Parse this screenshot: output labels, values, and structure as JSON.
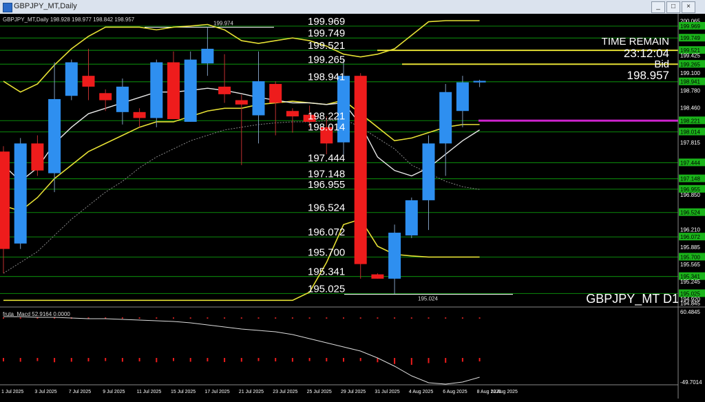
{
  "window": {
    "title": "GBPJPY_MT,Daily",
    "controls": [
      "minimize",
      "restore",
      "close"
    ]
  },
  "chart_header": "GBPJPY_MT,Daily  198.928 198.977 198.842 198.957",
  "symbol_label": "GBPJPY_MT D1",
  "time_remain": {
    "label": "TIME REMAIN",
    "value": "23:12:04"
  },
  "bid": {
    "label": "Bid",
    "value": "198.957"
  },
  "level_labels": [
    "199.969",
    "199.749",
    "199.521",
    "199.265",
    "198.941",
    "198.221",
    "198.014",
    "197.444",
    "197.148",
    "196.955",
    "196.524",
    "196.072",
    "195.700",
    "195.341",
    "195.025"
  ],
  "high_marker": "199.974",
  "low_marker": "195.024",
  "price_axis": [
    "200.065",
    "199.969",
    "199.749",
    "199.521",
    "199.425",
    "199.265",
    "199.100",
    "198.941",
    "198.780",
    "198.460",
    "198.221",
    "198.014",
    "197.815",
    "197.444",
    "197.148",
    "196.955",
    "196.850",
    "196.524",
    "196.210",
    "196.072",
    "195.885",
    "195.700",
    "195.565",
    "195.341",
    "195.245",
    "195.025",
    "194.920",
    "194.845"
  ],
  "axis_highlights": [
    "199.969",
    "199.749",
    "199.521",
    "199.265",
    "198.941",
    "198.221",
    "198.014",
    "197.444",
    "197.148",
    "196.955",
    "196.524",
    "196.072",
    "195.700",
    "195.341",
    "195.025"
  ],
  "macd": {
    "label": "fruta_Macd 52.9164 0.0000",
    "axis_top": "60.4845",
    "axis_bottom": "-49.7014"
  },
  "time_axis": [
    "1 Jul 2025",
    "3 Jul 2025",
    "7 Jul 2025",
    "9 Jul 2025",
    "11 Jul 2025",
    "15 Jul 2025",
    "17 Jul 2025",
    "21 Jul 2025",
    "23 Jul 2025",
    "25 Jul 2025",
    "29 Jul 2025",
    "31 Jul 2025",
    "4 Aug 2025",
    "6 Aug 2025",
    "8 Aug 2025",
    "12 Aug 2025"
  ],
  "colors": {
    "bull": "#2e8ff0",
    "bear": "#ee1c1c",
    "level_line": "#0a7a0a",
    "band": "#e6e034",
    "mid": "#e8e8e8",
    "magenta": "#cc22cc"
  },
  "chart_data": {
    "type": "candlestick",
    "series": [
      {
        "name": "GBPJPY_MT,Daily",
        "candles": [
          {
            "o": 197.65,
            "h": 197.75,
            "l": 195.4,
            "c": 195.85
          },
          {
            "o": 195.95,
            "h": 197.9,
            "l": 195.85,
            "c": 197.8
          },
          {
            "o": 197.8,
            "h": 197.95,
            "l": 197.2,
            "c": 197.3
          },
          {
            "o": 197.25,
            "h": 199.3,
            "l": 196.9,
            "c": 198.62
          },
          {
            "o": 198.68,
            "h": 199.35,
            "l": 198.6,
            "c": 199.3
          },
          {
            "o": 199.05,
            "h": 199.55,
            "l": 198.6,
            "c": 198.85
          },
          {
            "o": 198.73,
            "h": 198.8,
            "l": 198.4,
            "c": 198.6
          },
          {
            "o": 198.38,
            "h": 199.0,
            "l": 198.15,
            "c": 198.85
          },
          {
            "o": 198.38,
            "h": 198.45,
            "l": 198.1,
            "c": 198.27
          },
          {
            "o": 198.27,
            "h": 199.35,
            "l": 198.1,
            "c": 199.3
          },
          {
            "o": 199.3,
            "h": 199.5,
            "l": 198.4,
            "c": 198.25
          },
          {
            "o": 198.2,
            "h": 199.5,
            "l": 198.2,
            "c": 199.35
          },
          {
            "o": 199.28,
            "h": 199.95,
            "l": 199.05,
            "c": 199.55
          },
          {
            "o": 198.85,
            "h": 199.45,
            "l": 198.55,
            "c": 198.71
          },
          {
            "o": 198.6,
            "h": 198.7,
            "l": 197.4,
            "c": 198.52
          },
          {
            "o": 198.32,
            "h": 199.5,
            "l": 197.8,
            "c": 198.95
          },
          {
            "o": 198.9,
            "h": 198.95,
            "l": 197.95,
            "c": 198.55
          },
          {
            "o": 198.4,
            "h": 198.45,
            "l": 198.0,
            "c": 198.3
          },
          {
            "o": 198.33,
            "h": 198.5,
            "l": 198.1,
            "c": 198.2
          },
          {
            "o": 198.1,
            "h": 198.3,
            "l": 197.6,
            "c": 197.8
          },
          {
            "o": 197.82,
            "h": 199.35,
            "l": 197.6,
            "c": 199.05
          },
          {
            "o": 199.05,
            "h": 199.1,
            "l": 195.3,
            "c": 195.57
          },
          {
            "o": 195.38,
            "h": 195.4,
            "l": 195.3,
            "c": 195.3
          },
          {
            "o": 195.3,
            "h": 196.3,
            "l": 195.02,
            "c": 196.15
          },
          {
            "o": 196.1,
            "h": 196.8,
            "l": 196.05,
            "c": 196.75
          },
          {
            "o": 196.75,
            "h": 197.95,
            "l": 196.2,
            "c": 197.8
          },
          {
            "o": 197.8,
            "h": 198.9,
            "l": 197.2,
            "c": 198.75
          },
          {
            "o": 198.4,
            "h": 199.05,
            "l": 198.1,
            "c": 198.93
          },
          {
            "o": 198.928,
            "h": 198.977,
            "l": 198.842,
            "c": 198.957
          }
        ]
      }
    ],
    "horizontal_levels": [
      199.969,
      199.749,
      199.521,
      199.265,
      198.941,
      198.221,
      198.014,
      197.444,
      197.148,
      196.955,
      196.524,
      196.072,
      195.7,
      195.341,
      195.025
    ],
    "ylim": [
      194.84,
      200.07
    ],
    "macd_histogram": [
      -20,
      -22,
      -18,
      -25,
      -22,
      -20,
      -18,
      -22,
      -20,
      -25,
      -18,
      -22,
      -20,
      -24,
      -22,
      -18,
      -20,
      -22,
      -18,
      -20,
      -22,
      -18,
      -25,
      -35,
      -40,
      -30,
      -28,
      -22,
      -20
    ],
    "grid": false
  }
}
